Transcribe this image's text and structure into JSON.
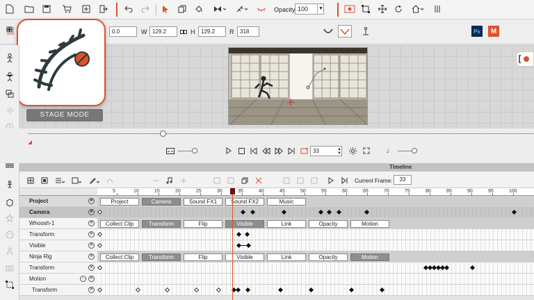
{
  "toolbar": {
    "opacity_label": "Opacity :",
    "opacity_value": "100"
  },
  "transform": {
    "y_value": "0.0",
    "w_label": "W",
    "w_value": "129.2",
    "h_label": "H",
    "h_value": "129.2",
    "r_label": "R",
    "r_value": "318",
    "ps_label": "Ps",
    "m_label": "M"
  },
  "stage": {
    "mode_badge": "STAGE MODE"
  },
  "playback": {
    "frame_value": "33"
  },
  "timeline": {
    "title": "Timeline",
    "current_frame_label": "Current Frame:",
    "current_frame_value": "33",
    "ruler_ticks": [
      "5",
      "10",
      "15",
      "20",
      "25",
      "30",
      "35",
      "40",
      "45",
      "50",
      "55",
      "60",
      "65",
      "70",
      "75",
      "80",
      "85",
      "90",
      "95",
      "100"
    ],
    "tracks": {
      "project": "Project",
      "camera": "Camera",
      "whoosh": "Whoosh-1",
      "transform": "Transform",
      "visible": "Visible",
      "ninja": "Ninja Rig",
      "ninja_transform": "Transform",
      "motion": "Motion",
      "motion_transform": "Transform"
    },
    "project_chips": [
      "Project",
      "Camera",
      "Sound FX1",
      "Sound FX2",
      "Music"
    ],
    "whoosh_chips": [
      "Collect Clip",
      "Transform",
      "Flip",
      "Visible",
      "Link",
      "Opacity",
      "Motion"
    ],
    "ninja_chips": [
      "Collect Clip",
      "Transform",
      "Flip",
      "Visible",
      "Link",
      "Opacity",
      "Motion"
    ]
  },
  "colors": {
    "accent": "#d9532b",
    "playhead_cap": "#6b0f0f"
  }
}
